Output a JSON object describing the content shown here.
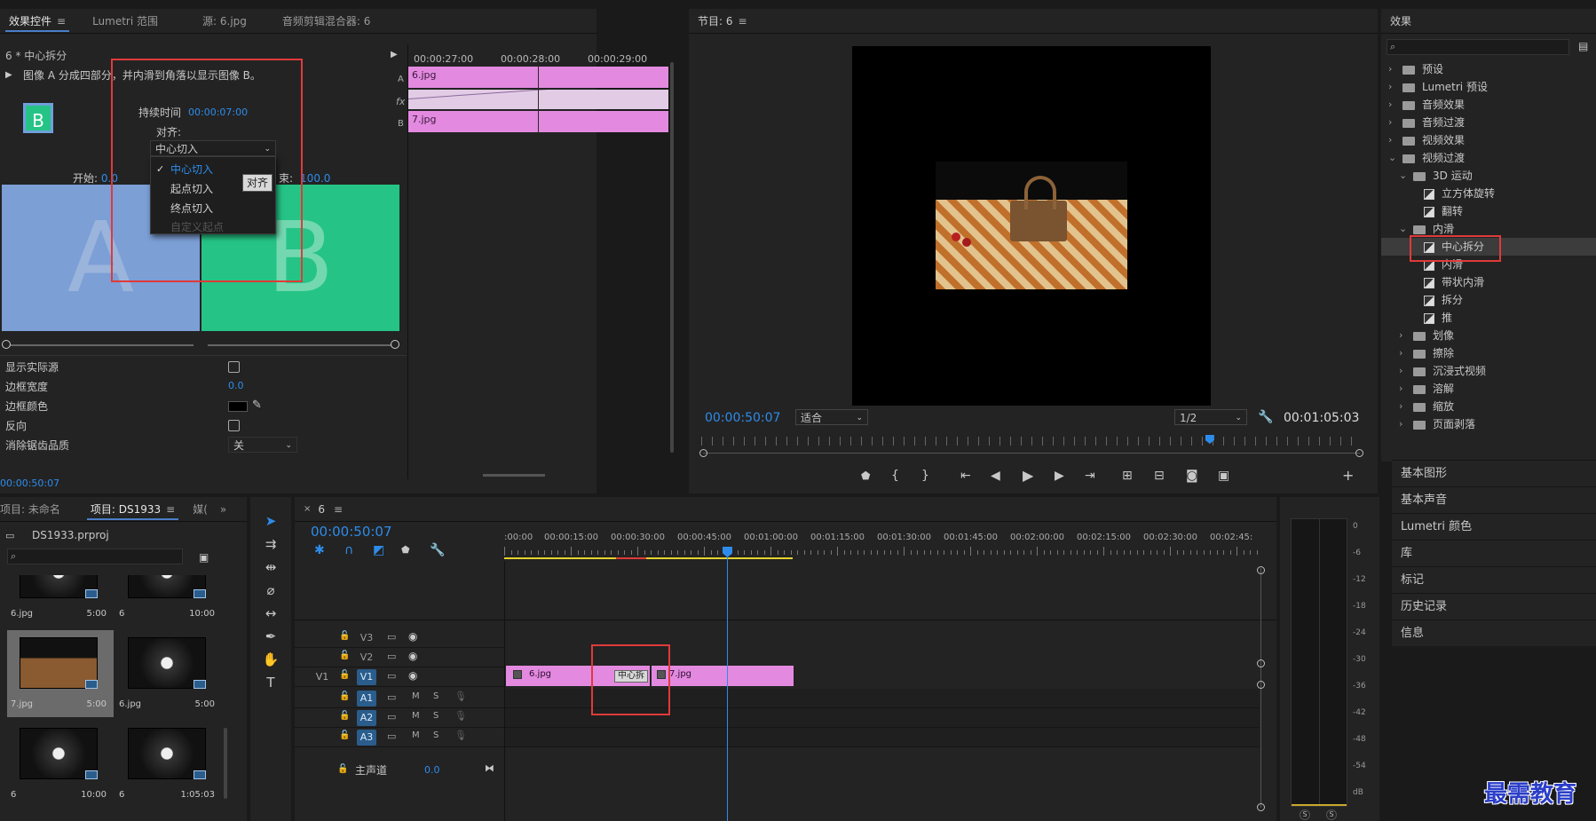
{
  "effect_controls": {
    "tabs": [
      "效果控件",
      "Lumetri 范围",
      "源: 6.jpg",
      "音频剪辑混合器: 6"
    ],
    "clip_title": "6 * 中心拆分",
    "description": "图像 A 分成四部分，并内滑到角落以显示图像 B。",
    "thumb_letter": "B",
    "duration_label": "持续时间",
    "duration_value": "00:00:07:00",
    "align_label": "对齐:",
    "align_value": "中心切入",
    "align_options": [
      "中心切入",
      "起点切入",
      "终点切入",
      "自定义起点"
    ],
    "align_tooltip": "对齐",
    "start_label": "开始:",
    "start_value": "0.0",
    "end_label": "束:",
    "end_value": "100.0",
    "preview_a": "A",
    "preview_b": "B",
    "show_source_label": "显示实际源",
    "border_width_label": "边框宽度",
    "border_width_value": "0.0",
    "border_color_label": "边框颜色",
    "reverse_label": "反向",
    "antialias_label": "消除锯齿品质",
    "antialias_value": "关",
    "mini_times": [
      "00:00:27:00",
      "00:00:28:00",
      "00:00:29:00"
    ],
    "clip_a": "6.jpg",
    "clip_b": "7.jpg",
    "track_a": "A",
    "track_b": "B",
    "fx_mark": "fx",
    "timecode": "00:00:50:07"
  },
  "program": {
    "title": "节目: 6",
    "timecode": "00:00:50:07",
    "fit": "适合",
    "resolution": "1/2",
    "duration": "00:01:05:03",
    "playhead_fraction": 0.77
  },
  "effects": {
    "title": "效果",
    "tree": [
      {
        "label": "预设",
        "level": 0,
        "type": "folder",
        "open": false
      },
      {
        "label": "Lumetri 预设",
        "level": 0,
        "type": "folder",
        "open": false
      },
      {
        "label": "音频效果",
        "level": 0,
        "type": "folder",
        "open": false
      },
      {
        "label": "音频过渡",
        "level": 0,
        "type": "folder",
        "open": false
      },
      {
        "label": "视频效果",
        "level": 0,
        "type": "folder",
        "open": false
      },
      {
        "label": "视频过渡",
        "level": 0,
        "type": "folder",
        "open": true
      },
      {
        "label": "3D 运动",
        "level": 1,
        "type": "folder",
        "open": true
      },
      {
        "label": "立方体旋转",
        "level": 2,
        "type": "effect"
      },
      {
        "label": "翻转",
        "level": 2,
        "type": "effect"
      },
      {
        "label": "内滑",
        "level": 1,
        "type": "folder",
        "open": true
      },
      {
        "label": "中心拆分",
        "level": 2,
        "type": "effect",
        "selected": true
      },
      {
        "label": "内滑",
        "level": 2,
        "type": "effect"
      },
      {
        "label": "带状内滑",
        "level": 2,
        "type": "effect"
      },
      {
        "label": "拆分",
        "level": 2,
        "type": "effect"
      },
      {
        "label": "推",
        "level": 2,
        "type": "effect"
      },
      {
        "label": "划像",
        "level": 1,
        "type": "folder",
        "open": false
      },
      {
        "label": "擦除",
        "level": 1,
        "type": "folder",
        "open": false
      },
      {
        "label": "沉浸式视频",
        "level": 1,
        "type": "folder",
        "open": false
      },
      {
        "label": "溶解",
        "level": 1,
        "type": "folder",
        "open": false
      },
      {
        "label": "缩放",
        "level": 1,
        "type": "folder",
        "open": false
      },
      {
        "label": "页面剥落",
        "level": 1,
        "type": "folder",
        "open": false
      }
    ],
    "side_panels": [
      "基本图形",
      "基本声音",
      "Lumetri 颜色",
      "库",
      "标记",
      "历史记录",
      "信息"
    ]
  },
  "project": {
    "tabs": [
      "项目: 未命名",
      "项目: DS1933",
      "媒("
    ],
    "file": "DS1933.prproj",
    "items": [
      {
        "name": "6.jpg",
        "duration": "5:00"
      },
      {
        "name": "6",
        "duration": "10:00"
      },
      {
        "name": "7.jpg",
        "duration": "5:00"
      },
      {
        "name": "6.jpg",
        "duration": "5:00"
      },
      {
        "name": "6",
        "duration": "10:00"
      },
      {
        "name": "6",
        "duration": "1:05:03"
      }
    ]
  },
  "timeline": {
    "tab": "6",
    "timecode": "00:00:50:07",
    "ruler": [
      ":00:00",
      "00:00:15:00",
      "00:00:30:00",
      "00:00:45:00",
      "00:01:00:00",
      "00:01:15:00",
      "00:01:30:00",
      "00:01:45:00",
      "00:02:00:00",
      "00:02:15:00",
      "00:02:30:00",
      "00:02:45:"
    ],
    "video_tracks": [
      "V3",
      "V2",
      "V1"
    ],
    "audio_tracks": [
      "A1",
      "A2",
      "A3"
    ],
    "source_v": "V1",
    "master_label": "主声道",
    "master_value": "0.0",
    "clip1": "6.jpg",
    "clip2": "7.jpg",
    "transition": "中心拆",
    "m": "M",
    "s": "S"
  },
  "meter": {
    "labels": [
      "0",
      "-6",
      "-12",
      "-18",
      "-24",
      "-30",
      "-36",
      "-42",
      "-48",
      "-54",
      "dB"
    ],
    "s": "S"
  },
  "watermark": "最需教育"
}
